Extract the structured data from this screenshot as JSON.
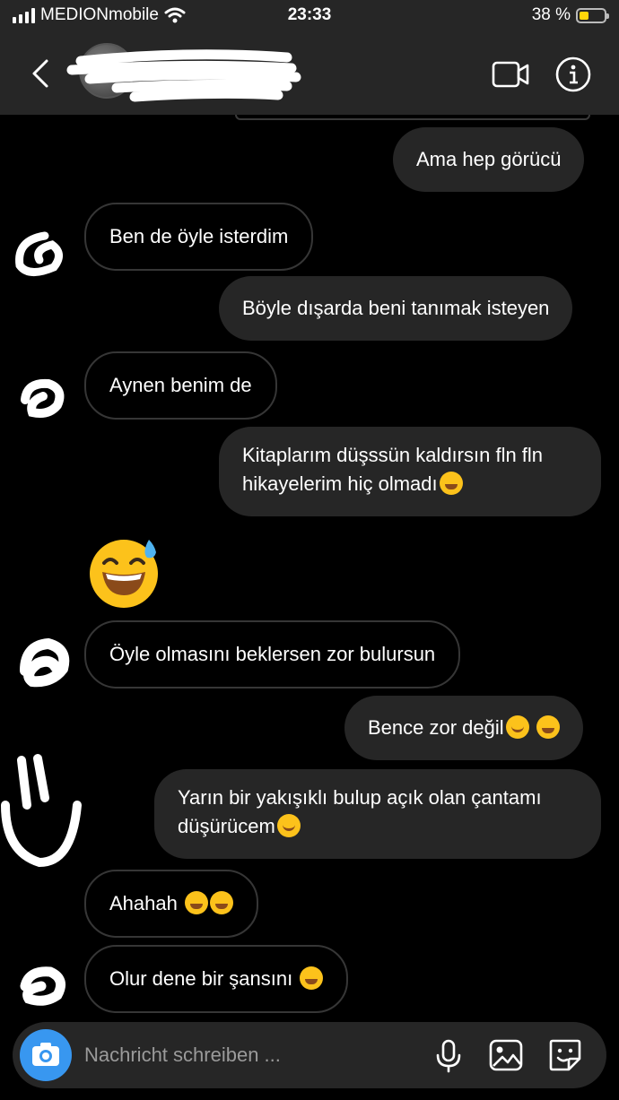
{
  "status_bar": {
    "carrier": "MEDIONmobile",
    "time": "23:33",
    "battery_percent": "38 %",
    "battery_level": 0.38
  },
  "header": {
    "back_icon": "chevron-left-icon",
    "video_icon": "video-camera-icon",
    "info_icon": "info-icon"
  },
  "messages": [
    {
      "direction": "outgoing",
      "text": "Ama hep görücü"
    },
    {
      "direction": "incoming",
      "text": "Ben de öyle isterdim"
    },
    {
      "direction": "outgoing",
      "text": "Böyle dışarda beni tanımak isteyen"
    },
    {
      "direction": "incoming",
      "text": "Aynen benim de"
    },
    {
      "direction": "outgoing",
      "line1": "Kitaplarım düşssün kaldırsın fln fln",
      "line2": "hikayelerim hiç olmadı",
      "emoji": "grinning-sweat-emoji"
    },
    {
      "direction": "outgoing",
      "emoji_only": "grinning-sweat-emoji"
    },
    {
      "direction": "incoming",
      "text": "Öyle olmasını beklersen zor bulursun"
    },
    {
      "direction": "outgoing",
      "text": "Bence zor değil",
      "emojis": [
        "smiling-blush-emoji",
        "grinning-sweat-emoji"
      ]
    },
    {
      "direction": "outgoing",
      "line1": "Yarın bir yakışıklı bulup açık olan çantamı",
      "line2": "düşürücem",
      "emoji": "slight-smile-emoji"
    },
    {
      "direction": "incoming",
      "text": "Ahahah",
      "emojis": [
        "tears-of-joy-emoji",
        "tears-of-joy-emoji"
      ]
    },
    {
      "direction": "incoming",
      "text": "Olur dene bir şansını",
      "emojis": [
        "tears-of-joy-emoji"
      ]
    }
  ],
  "composer": {
    "placeholder": "Nachricht schreiben ...",
    "camera_icon": "camera-icon",
    "mic_icon": "microphone-icon",
    "gallery_icon": "gallery-icon",
    "sticker_icon": "sticker-icon"
  },
  "colors": {
    "background": "#000000",
    "bar": "#262626",
    "outgoing_bubble": "#262626",
    "incoming_border": "#363636",
    "camera_button": "#3897f0",
    "battery": "#ffd60a"
  }
}
